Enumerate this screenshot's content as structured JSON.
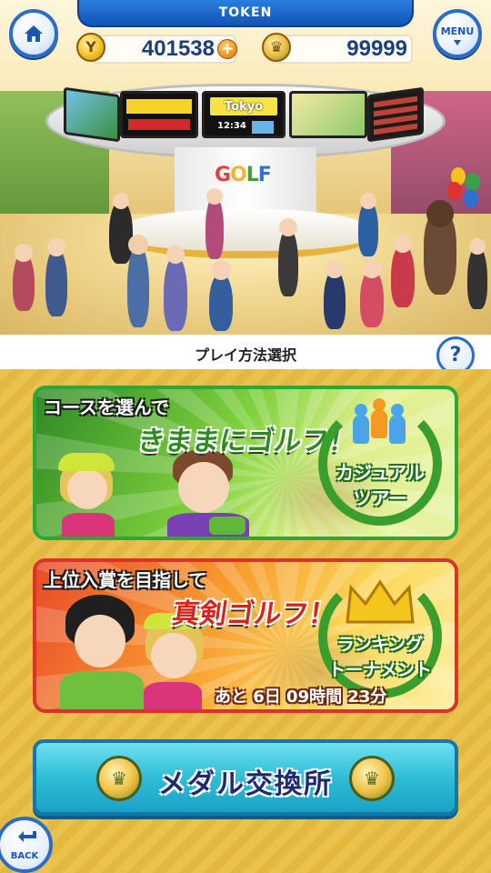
{
  "header": {
    "title": "TOKEN",
    "home_icon": "home-icon",
    "menu_label": "MENU",
    "menu_icon": "chevron-down-icon"
  },
  "currency": {
    "coins": {
      "icon": "golf-coin-icon",
      "value": "401538"
    },
    "medals": {
      "icon": "crown-medal-icon",
      "value": "99999"
    }
  },
  "lobby": {
    "monitor_city": "Tokyo",
    "monitor_time": "12:34",
    "logo_letters": [
      "G",
      "O",
      "L",
      "F"
    ]
  },
  "section": {
    "title": "プレイ方法選択",
    "help_label": "?"
  },
  "modes": [
    {
      "tagline": "コースを選んで",
      "headline": "きままにゴルフ！",
      "badge_line1": "カジュアル",
      "badge_line2": "ツアー"
    },
    {
      "tagline": "上位入賞を目指して",
      "headline": "真剣ゴルフ！",
      "badge_line1": "ランキング",
      "badge_line2": "トーナメント",
      "time_left": "あと 6日 09時間 23分"
    }
  ],
  "medal_exchange": {
    "label": "メダル交換所"
  },
  "footer": {
    "back_label": "BACK"
  },
  "colors": {
    "header_blue": "#1a5fc4",
    "casual_green": "#2aa93a",
    "ranking_red": "#d9342b",
    "medal_cyan": "#2fbdd7",
    "stripe_gold": "#eac34f"
  }
}
